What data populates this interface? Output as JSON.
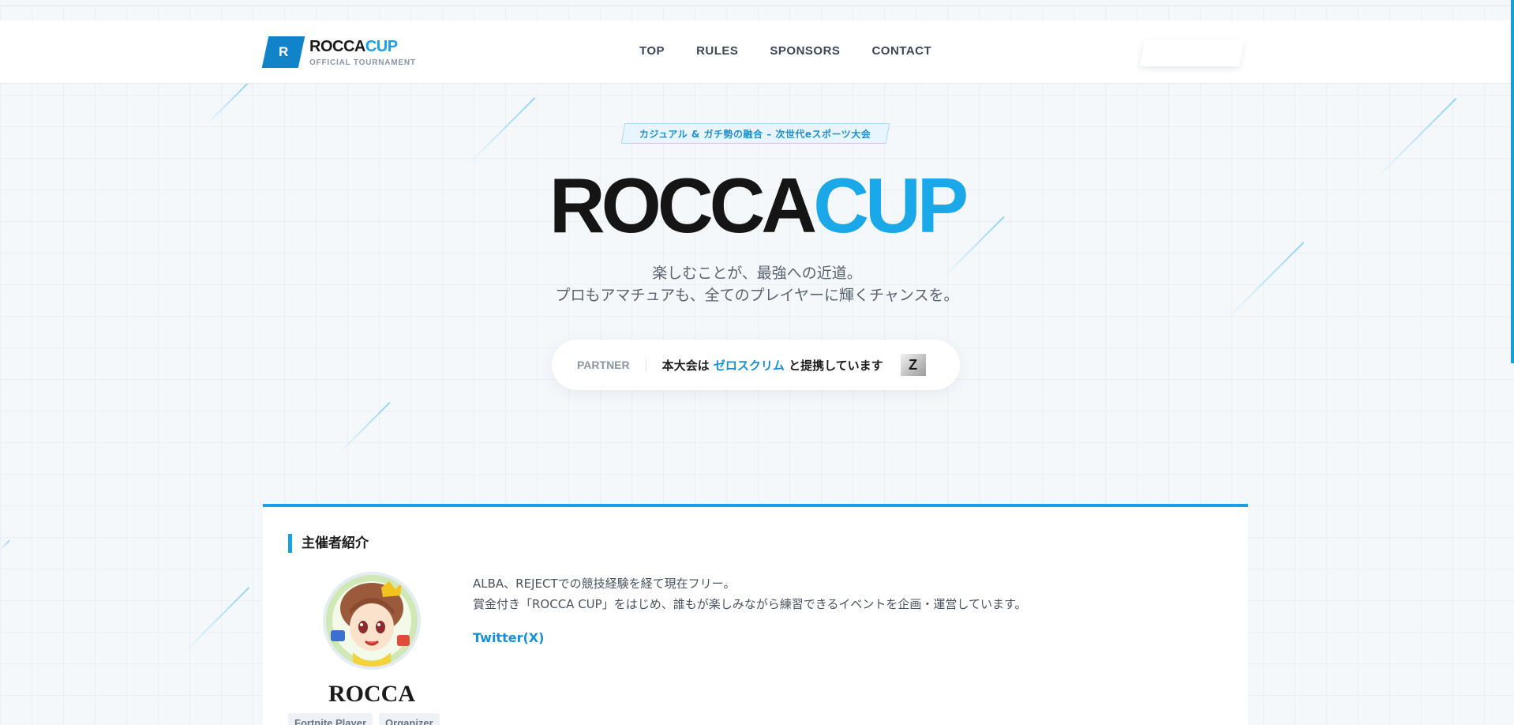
{
  "colors": {
    "accent": "#1aa0e6",
    "brand_dark": "#1083c9",
    "text_dark": "#151515"
  },
  "header": {
    "logo_mark": "R",
    "logo_main_a": "ROCCA",
    "logo_main_b": "CUP",
    "logo_sub": "OFFICIAL TOURNAMENT",
    "nav": [
      "TOP",
      "RULES",
      "SPONSORS",
      "CONTACT"
    ]
  },
  "hero": {
    "badge": "カジュアル & ガチ勢の融合 – 次世代eスポーツ大会",
    "title_a": "ROCCA",
    "title_b": "CUP",
    "tagline_1": "楽しむことが、最強への近道。",
    "tagline_2": "プロもアマチュアも、全てのプレイヤーに輝くチャンスを。"
  },
  "partner": {
    "label": "PARTNER",
    "text_before": "本大会は ",
    "link": "ゼロスクリム",
    "text_after": " と提携しています",
    "icon": "zero-scrim-logo-icon",
    "icon_glyph": "Z"
  },
  "organizer": {
    "section_title": "主催者紹介",
    "name": "ROCCA",
    "tags": [
      "Fortnite Player",
      "Organizer"
    ],
    "bio_1": "ALBA、REJECTでの競技経験を経て現在フリー。",
    "bio_2": "賞金付き「ROCCA CUP」をはじめ、誰もが楽しみながら練習できるイベントを企画・運営しています。",
    "twitter": "Twitter(X)"
  }
}
